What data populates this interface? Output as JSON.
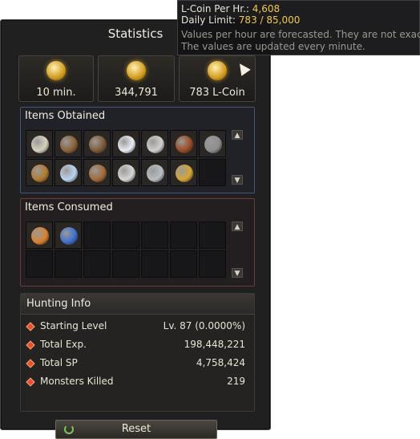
{
  "window": {
    "title": "Statistics"
  },
  "summary": [
    {
      "icon": "time-icon",
      "value": "10 min."
    },
    {
      "icon": "adena-icon",
      "value": "344,791"
    },
    {
      "icon": "l-coin-icon",
      "value": "783 L-Coin"
    }
  ],
  "tooltip": {
    "per_hr_label": "L-Coin Per Hr.:",
    "per_hr_value": "4,608",
    "limit_label": "Daily Limit:",
    "limit_value": "783 / 85,000",
    "note1": "Values per hour are forecasted. They are not exact.",
    "note2": "The values are updated every minute."
  },
  "items_obtained": {
    "title": "Items Obtained",
    "items": [
      {
        "icon": "bone-icon",
        "color": "#d8d0be"
      },
      {
        "icon": "pouch-icon",
        "color": "#8a6238"
      },
      {
        "icon": "pouch-icon",
        "color": "#7d5a35"
      },
      {
        "icon": "pearl-icon",
        "color": "#e9ecf2"
      },
      {
        "icon": "ingot-icon",
        "color": "#cfcfcf"
      },
      {
        "icon": "leather-icon",
        "color": "#9a4a22"
      },
      {
        "icon": "iron-ore-icon",
        "color": "#8e8e8e"
      },
      {
        "icon": "sack-icon",
        "color": "#b37a2e"
      },
      {
        "icon": "crystal-icon",
        "color": "#b9d4f0"
      },
      {
        "icon": "rope-icon",
        "color": "#a26a36"
      },
      {
        "icon": "stone-pile-icon",
        "color": "#d6d6d6"
      },
      {
        "icon": "silver-coin-icon",
        "color": "#b9bdc4"
      },
      {
        "icon": "fabric-icon",
        "color": "#d6a532"
      }
    ],
    "slots": 14
  },
  "items_consumed": {
    "title": "Items Consumed",
    "items": [
      {
        "icon": "bandage-icon",
        "color": "#d9822e"
      },
      {
        "icon": "potion-icon",
        "color": "#3d6fcf"
      }
    ],
    "slots": 14
  },
  "hunting_info": {
    "title": "Hunting Info",
    "rows": [
      {
        "label": "Starting Level",
        "value": "Lv. 87 (0.0000%)"
      },
      {
        "label": "Total Exp.",
        "value": "198,448,221"
      },
      {
        "label": "Total SP",
        "value": "4,758,424"
      },
      {
        "label": "Monsters Killed",
        "value": "219"
      }
    ]
  },
  "reset_label": "Reset"
}
